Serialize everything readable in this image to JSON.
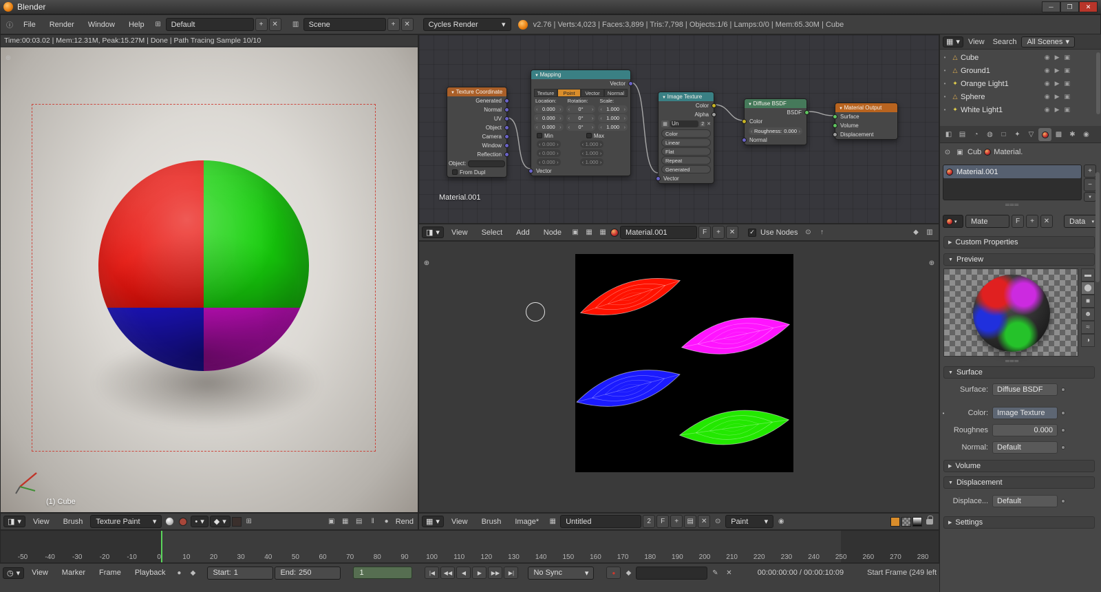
{
  "window": {
    "title": "Blender"
  },
  "icons": {
    "info": "ⓘ",
    "window_min": "─",
    "window_max": "❐",
    "window_close": "✕",
    "plus": "+",
    "minus": "−",
    "x": "✕",
    "dropdown": "▾",
    "tri_right": "▶",
    "tri_down": "▼",
    "check": "✓",
    "grid": "⊞",
    "clock": "◷",
    "eye": "◉",
    "select": "▶",
    "camera": "▣",
    "pause": "‖",
    "record": "●",
    "folder": "▤",
    "pencil": "✎",
    "image": "▦",
    "up_arrow": "↑",
    "dot": "•",
    "grip": "═══",
    "up_tri": "▲",
    "down_tri": "▼",
    "pin": "⊙",
    "screen": "▥",
    "layers": "▦",
    "key": "◆",
    "plus_circle": "⊕",
    "editor": "◨"
  },
  "infobar": {
    "menus": [
      "File",
      "Render",
      "Window",
      "Help"
    ],
    "layout_name": "Default",
    "scene_name": "Scene",
    "engine": "Cycles Render",
    "stats": "v2.76 | Verts:4,023 | Faces:3,899 | Tris:7,798 | Objects:1/6 | Lamps:0/0 | Mem:65.30M | Cube"
  },
  "viewport": {
    "render_status": "Time:00:03.02 | Mem:12.31M, Peak:15.27M | Done | Path Tracing Sample 10/10",
    "object_info": "(1) Cube",
    "menus": [
      "View",
      "Brush"
    ],
    "mode": "Texture Paint",
    "render_button": "Rend"
  },
  "node_editor": {
    "tree_label": "Material.001",
    "header": {
      "menus": [
        "View",
        "Select",
        "Add",
        "Node"
      ],
      "material": "Material.001",
      "f_label": "F",
      "use_nodes": "Use Nodes"
    },
    "texcoord": {
      "title": "Texture Coordinate",
      "outputs": [
        "Generated",
        "Normal",
        "UV",
        "Object",
        "Camera",
        "Window",
        "Reflection"
      ],
      "object_label": "Object:",
      "from_dupl": "From Dupl"
    },
    "mapping": {
      "title": "Mapping",
      "output": "Vector",
      "input": "Vector",
      "modes": [
        "Texture",
        "Point",
        "Vector",
        "Normal"
      ],
      "cols": [
        "Location:",
        "Rotation:",
        "Scale:"
      ],
      "loc": [
        "0.000",
        "0.000",
        "0.000"
      ],
      "rot": [
        "0°",
        "0°",
        "0°"
      ],
      "scl": [
        "1.000",
        "1.000",
        "1.000"
      ],
      "min": "Min",
      "max": "Max",
      "minv": [
        "0.000",
        "0.000",
        "0.000"
      ],
      "maxv": [
        "1.000",
        "1.000",
        "1.000"
      ]
    },
    "imagetex": {
      "title": "Image Texture",
      "outputs": [
        "Color",
        "Alpha"
      ],
      "datablock": "Un",
      "users": "2",
      "fields": [
        "Color",
        "Linear",
        "Flat",
        "Repeat",
        "Generated"
      ],
      "input": "Vector"
    },
    "diffuse": {
      "title": "Diffuse BSDF",
      "output": "BSDF",
      "color_label": "Color",
      "roughness_label": "Roughness:",
      "roughness": "0.000",
      "normal_label": "Normal"
    },
    "output_node": {
      "title": "Material Output",
      "inputs": [
        "Surface",
        "Volume",
        "Displacement"
      ]
    }
  },
  "image_editor": {
    "menus": [
      "View",
      "Brush",
      "Image*"
    ],
    "image_name": "Untitled",
    "users": "2",
    "f_label": "F",
    "mode": "Paint"
  },
  "timeline": {
    "ticks": [
      "-50",
      "-40",
      "-30",
      "-20",
      "-10",
      "0",
      "10",
      "20",
      "30",
      "40",
      "50",
      "60",
      "70",
      "80",
      "90",
      "100",
      "110",
      "120",
      "130",
      "140",
      "150",
      "160",
      "170",
      "180",
      "190",
      "200",
      "210",
      "220",
      "230",
      "240",
      "250",
      "260",
      "270",
      "280"
    ],
    "menus": [
      "View",
      "Marker",
      "Frame",
      "Playback"
    ],
    "start_label": "Start:",
    "start": "1",
    "end_label": "End:",
    "end": "250",
    "current": "1",
    "transport": [
      "|◀",
      "◀◀",
      "◀",
      "▶",
      "▶▶",
      "▶|"
    ],
    "sync": "No Sync",
    "timecode": "00:00:00:00 / 00:00:10:09",
    "status_hint": "Start Frame (249 left"
  },
  "outliner": {
    "menus": [
      "View",
      "Search"
    ],
    "filter": "All Scenes",
    "items": [
      "Cube",
      "Ground1",
      "Orange Light1",
      "Sphere",
      "White Light1"
    ],
    "item_icons": [
      "△",
      "△",
      "✦",
      "△",
      "✦"
    ]
  },
  "properties": {
    "tab_icons": [
      "◧",
      "▤",
      "◔",
      "◍",
      "□",
      "✦",
      "▽",
      "",
      "▩",
      "✱",
      "◉"
    ],
    "breadcrumb_object": "Cub",
    "breadcrumb_material": "Material.",
    "slot_name": "Material.001",
    "id_name": "Mate",
    "id_f": "F",
    "id_link": "Data",
    "sec_custom": "Custom Properties",
    "sec_preview": "Preview",
    "sec_surface": "Surface",
    "sec_volume": "Volume",
    "sec_displacement": "Displacement",
    "sec_settings": "Settings",
    "surface_label": "Surface:",
    "surface_value": "Diffuse BSDF",
    "color_label": "Color:",
    "color_value": "Image Texture",
    "roughness_label": "Roughnes",
    "roughness_value": "0.000",
    "normal_label": "Normal:",
    "normal_value": "Default",
    "displace_label": "Displace...",
    "displace_value": "Default",
    "preview_icons": [
      "▬",
      "⬤",
      "■",
      "☻",
      "≈",
      "◑"
    ]
  },
  "colors": {
    "accent": "#d98d2b",
    "sphere_top_left": "#e8130c",
    "sphere_top_right": "#17d20c",
    "sphere_bottom_left": "#2016d8",
    "sphere_bottom_right": "#e412de",
    "uv_red": "#ff1200",
    "uv_magenta": "#ff14ff",
    "uv_blue": "#1b1bff",
    "uv_green": "#23e800",
    "node_header_input": "#aa5f28",
    "node_header_vector": "#3a8084",
    "node_header_shader": "#45795a",
    "node_header_output": "#b9641f"
  }
}
